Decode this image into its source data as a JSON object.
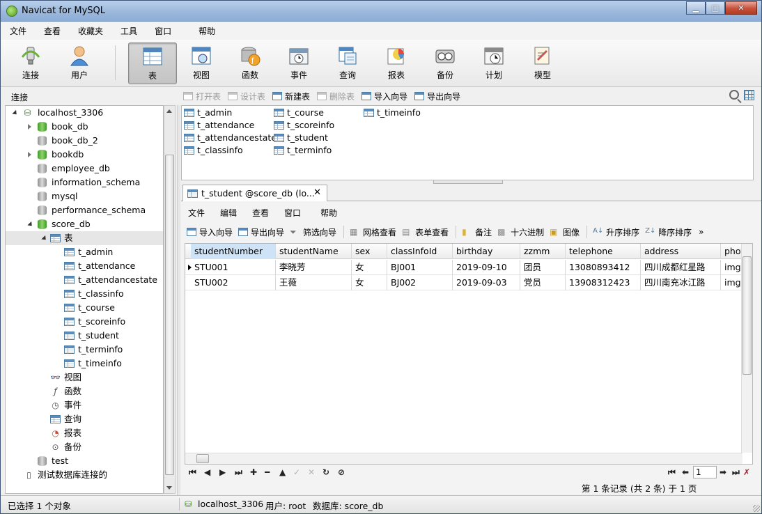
{
  "window": {
    "title": "Navicat for MySQL"
  },
  "menu": [
    "文件",
    "查看",
    "收藏夹",
    "工具",
    "窗口",
    "帮助"
  ],
  "toolbar": [
    {
      "label": "连接",
      "icon": "connection-plug-icon"
    },
    {
      "label": "用户",
      "icon": "user-icon"
    },
    {
      "label": "表",
      "icon": "table-icon",
      "active": true
    },
    {
      "label": "视图",
      "icon": "view-icon"
    },
    {
      "label": "函数",
      "icon": "function-icon"
    },
    {
      "label": "事件",
      "icon": "event-clock-icon"
    },
    {
      "label": "查询",
      "icon": "query-icon"
    },
    {
      "label": "报表",
      "icon": "report-icon"
    },
    {
      "label": "备份",
      "icon": "backup-icon"
    },
    {
      "label": "计划",
      "icon": "schedule-icon"
    },
    {
      "label": "模型",
      "icon": "model-icon"
    }
  ],
  "sidebar": {
    "header": "连接",
    "connection": "localhost_3306",
    "databases": [
      "book_db",
      "book_db_2",
      "bookdb",
      "employee_db",
      "information_schema",
      "mysql",
      "performance_schema",
      "score_db"
    ],
    "open_db": "score_db",
    "tables_group": "表",
    "tables": [
      "t_admin",
      "t_attendance",
      "t_attendancestate",
      "t_classinfo",
      "t_course",
      "t_scoreinfo",
      "t_student",
      "t_terminfo",
      "t_timeinfo"
    ],
    "other_groups": [
      "视图",
      "函数",
      "事件",
      "查询",
      "报表",
      "备份"
    ],
    "after": [
      "test",
      "测试数据库连接的"
    ]
  },
  "object_toolbar": [
    "打开表",
    "设计表",
    "新建表",
    "删除表",
    "导入向导",
    "导出向导"
  ],
  "object_list": [
    "t_admin",
    "t_attendance",
    "t_attendancestate",
    "t_classinfo",
    "t_course",
    "t_scoreinfo",
    "t_student",
    "t_terminfo",
    "t_timeinfo"
  ],
  "tab": {
    "title": "t_student @score_db (lo...",
    "close": "✕"
  },
  "inner_menu": [
    "文件",
    "编辑",
    "查看",
    "窗口",
    "帮助"
  ],
  "inner_toolbar": [
    "导入向导",
    "导出向导",
    "筛选向导",
    "网格查看",
    "表单查看",
    "备注",
    "十六进制",
    "图像",
    "升序排序",
    "降序排序"
  ],
  "grid": {
    "columns": [
      "studentNumber",
      "studentName",
      "sex",
      "classInfoId",
      "birthday",
      "zzmm",
      "telephone",
      "address",
      "phot"
    ],
    "rows": [
      [
        "STU001",
        "李晓芳",
        "女",
        "BJ001",
        "2019-09-10",
        "团员",
        "13080893412",
        "四川成都红星路",
        "img/"
      ],
      [
        "STU002",
        "王薇",
        "女",
        "BJ002",
        "2019-09-03",
        "党员",
        "13908312423",
        "四川南充冰江路",
        "img/"
      ]
    ]
  },
  "nav": {
    "page": "1",
    "record_info": "第 1 条记录 (共 2 条) 于 1 页"
  },
  "status": {
    "left": "已选择 1 个对象",
    "connection": "localhost_3306",
    "user": "用户: root",
    "database": "数据库: score_db"
  },
  "colors": {
    "selected_header": "#cfe3f7",
    "titlebar": "#9cb8dc",
    "close_button": "#c6513a"
  }
}
